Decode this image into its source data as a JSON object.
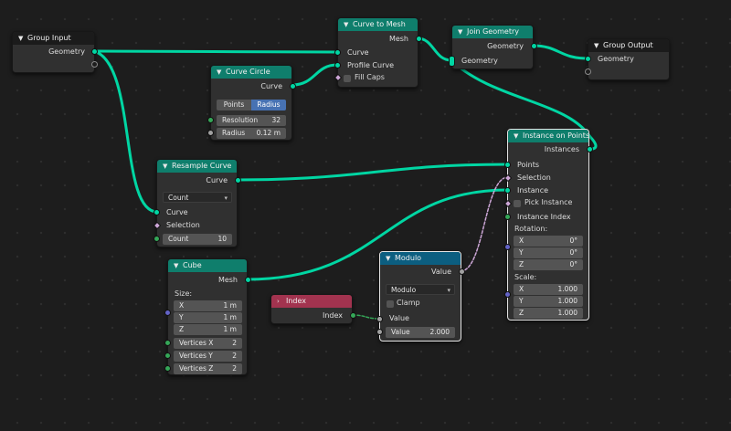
{
  "colors": {
    "geometry_link": "#00d6a3",
    "geometry_header": "#0f7e6c",
    "utility_header": "#0c5e80",
    "input_header": "#a2334f",
    "bool_link": "#cca6d6",
    "int_link": "#35a758",
    "selected_border": "#e4e4e4"
  },
  "nodes": {
    "group_input": {
      "title": "Group Input",
      "geometry": "Geometry"
    },
    "curve_to_mesh": {
      "title": "Curve to Mesh",
      "mesh": "Mesh",
      "curve": "Curve",
      "profile_curve": "Profile Curve",
      "fill_caps": "Fill Caps"
    },
    "join_geometry": {
      "title": "Join Geometry",
      "geometry_out": "Geometry",
      "geometry_in": "Geometry"
    },
    "group_output": {
      "title": "Group Output",
      "geometry": "Geometry"
    },
    "curve_circle": {
      "title": "Curve Circle",
      "curve": "Curve",
      "mode_points": "Points",
      "mode_radius": "Radius",
      "active_mode": "Radius",
      "resolution_label": "Resolution",
      "resolution_value": "32",
      "radius_label": "Radius",
      "radius_value": "0.12 m"
    },
    "instance_on_points": {
      "title": "Instance on Points",
      "instances": "Instances",
      "points": "Points",
      "selection": "Selection",
      "instance": "Instance",
      "pick_instance": "Pick Instance",
      "instance_index": "Instance Index",
      "rotation_label": "Rotation:",
      "rotation": [
        {
          "axis": "X",
          "value": "0°"
        },
        {
          "axis": "Y",
          "value": "0°"
        },
        {
          "axis": "Z",
          "value": "0°"
        }
      ],
      "scale_label": "Scale:",
      "scale": [
        {
          "axis": "X",
          "value": "1.000"
        },
        {
          "axis": "Y",
          "value": "1.000"
        },
        {
          "axis": "Z",
          "value": "1.000"
        }
      ]
    },
    "resample_curve": {
      "title": "Resample Curve",
      "curve_out": "Curve",
      "mode": "Count",
      "curve_in": "Curve",
      "selection": "Selection",
      "count_label": "Count",
      "count_value": "10"
    },
    "cube": {
      "title": "Cube",
      "mesh": "Mesh",
      "size_label": "Size:",
      "size": [
        {
          "axis": "X",
          "value": "1 m"
        },
        {
          "axis": "Y",
          "value": "1 m"
        },
        {
          "axis": "Z",
          "value": "1 m"
        }
      ],
      "vertices": [
        {
          "label": "Vertices X",
          "value": "2"
        },
        {
          "label": "Vertices Y",
          "value": "2"
        },
        {
          "label": "Vertices Z",
          "value": "2"
        }
      ]
    },
    "modulo": {
      "title": "Modulo",
      "value_out": "Value",
      "operation": "Modulo",
      "clamp": "Clamp",
      "value_in": "Value",
      "value2_label": "Value",
      "value2": "2.000"
    },
    "index": {
      "title": "Index",
      "index": "Index"
    }
  }
}
